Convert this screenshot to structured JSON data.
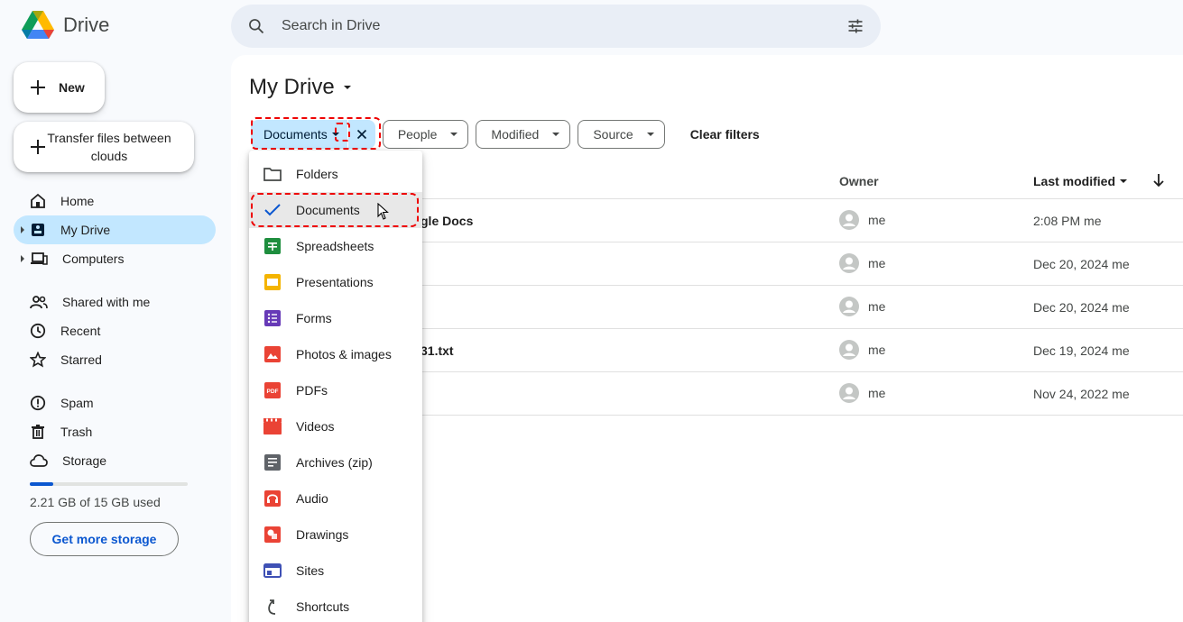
{
  "app": {
    "title": "Drive"
  },
  "search": {
    "placeholder": "Search in Drive"
  },
  "sidebar": {
    "new_label": "New",
    "transfer_label": "Transfer files between clouds",
    "items": [
      {
        "label": "Home",
        "icon": "home-icon"
      },
      {
        "label": "My Drive",
        "icon": "my-drive-icon",
        "active": true
      },
      {
        "label": "Computers",
        "icon": "computers-icon"
      },
      {
        "label": "Shared with me",
        "icon": "shared-icon"
      },
      {
        "label": "Recent",
        "icon": "recent-icon"
      },
      {
        "label": "Starred",
        "icon": "star-icon"
      },
      {
        "label": "Spam",
        "icon": "spam-icon"
      },
      {
        "label": "Trash",
        "icon": "trash-icon"
      },
      {
        "label": "Storage",
        "icon": "cloud-icon"
      }
    ],
    "storage_text": "2.21 GB of 15 GB used",
    "storage_fraction": 0.147,
    "get_storage_label": "Get more storage"
  },
  "main": {
    "title": "My Drive",
    "filters": {
      "active_label": "Documents",
      "chips": [
        "People",
        "Modified",
        "Source"
      ],
      "clear_label": "Clear filters"
    },
    "columns": {
      "owner": "Owner",
      "modified": "Last modified"
    },
    "rows": [
      {
        "name": "gle Docs",
        "owner": "me",
        "modified": "2:08 PM me"
      },
      {
        "name": "",
        "owner": "me",
        "modified": "Dec 20, 2024 me"
      },
      {
        "name": "",
        "owner": "me",
        "modified": "Dec 20, 2024 me"
      },
      {
        "name": "31.txt",
        "owner": "me",
        "modified": "Dec 19, 2024 me"
      },
      {
        "name": "",
        "owner": "me",
        "modified": "Nov 24, 2022 me"
      }
    ]
  },
  "menu": {
    "items": [
      {
        "label": "Folders",
        "icon": "folder-icon",
        "color": "#444746"
      },
      {
        "label": "Documents",
        "icon": "check-icon",
        "color": "#0b57d0",
        "selected": true
      },
      {
        "label": "Spreadsheets",
        "icon": "sheets-icon",
        "color": "#1e8e3e"
      },
      {
        "label": "Presentations",
        "icon": "slides-icon",
        "color": "#f4b400"
      },
      {
        "label": "Forms",
        "icon": "forms-icon",
        "color": "#673ab7"
      },
      {
        "label": "Photos & images",
        "icon": "image-icon",
        "color": "#ea4335"
      },
      {
        "label": "PDFs",
        "icon": "pdf-icon",
        "color": "#ea4335"
      },
      {
        "label": "Videos",
        "icon": "video-icon",
        "color": "#ea4335"
      },
      {
        "label": "Archives (zip)",
        "icon": "zip-icon",
        "color": "#5f6368"
      },
      {
        "label": "Audio",
        "icon": "audio-icon",
        "color": "#ea4335"
      },
      {
        "label": "Drawings",
        "icon": "drawings-icon",
        "color": "#ea4335"
      },
      {
        "label": "Sites",
        "icon": "sites-icon",
        "color": "#3f51b5"
      },
      {
        "label": "Shortcuts",
        "icon": "shortcut-icon",
        "color": "#444746"
      }
    ]
  }
}
